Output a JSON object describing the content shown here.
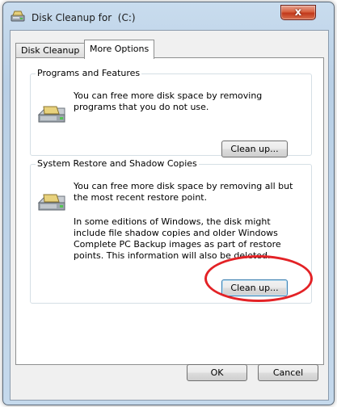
{
  "window": {
    "title": "Disk Cleanup for  (C:)",
    "close_label": "x"
  },
  "tabs": [
    {
      "label": "Disk Cleanup",
      "active": false
    },
    {
      "label": "More Options",
      "active": true
    }
  ],
  "groups": {
    "programs": {
      "title": "Programs and Features",
      "description": "You can free more disk space by removing programs that you do not use.",
      "button_label": "Clean up..."
    },
    "restore": {
      "title": "System Restore and Shadow Copies",
      "description": "You can free more disk space by removing all but the most recent restore point.",
      "description_extra": "In some editions of Windows, the disk might include file shadow copies and older Windows Complete PC Backup images as part of restore points. This information will also be deleted.",
      "button_label": "Clean up..."
    }
  },
  "footer": {
    "ok_label": "OK",
    "cancel_label": "Cancel"
  },
  "icons": {
    "app": "disk-cleanup-icon",
    "group": "hard-drive-icon"
  },
  "colors": {
    "annotation": "#e32226",
    "close_button": "#c2391b"
  }
}
